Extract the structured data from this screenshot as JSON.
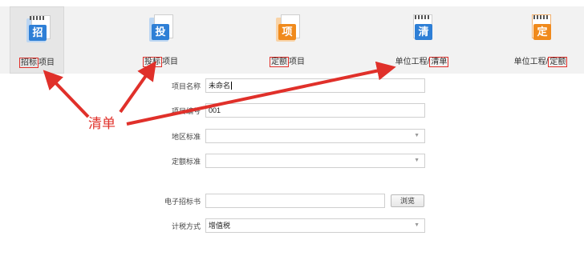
{
  "toolbar": {
    "items": [
      {
        "icon_char": "招",
        "label_hl": "招标",
        "label_rest": "项目",
        "color": "#2e7fd6"
      },
      {
        "icon_char": "投",
        "label_hl": "投标",
        "label_rest": "项目",
        "color": "#2e7fd6"
      },
      {
        "icon_char": "项",
        "label_hl": "定额",
        "label_rest": "项目",
        "color": "#f08a1c"
      },
      {
        "icon_char": "清",
        "label_pre": "单位工程/",
        "label_hl": "清单",
        "color": "#2e7fd6"
      },
      {
        "icon_char": "定",
        "label_pre": "单位工程/",
        "label_hl": "定额",
        "color": "#f08a1c"
      }
    ]
  },
  "form": {
    "project_name_label": "项目名称",
    "project_name_value": "未命名",
    "project_code_label": "项目编号",
    "project_code_value": "001",
    "region_label": "地区标准",
    "region_value": "",
    "quota_label": "定额标准",
    "quota_value": "",
    "tender_doc_label": "电子招标书",
    "tender_doc_value": "",
    "browse_label": "浏览",
    "tax_label": "计税方式",
    "tax_value": "增值税"
  },
  "annotation": {
    "text": "清单",
    "color": "#e0302a"
  }
}
